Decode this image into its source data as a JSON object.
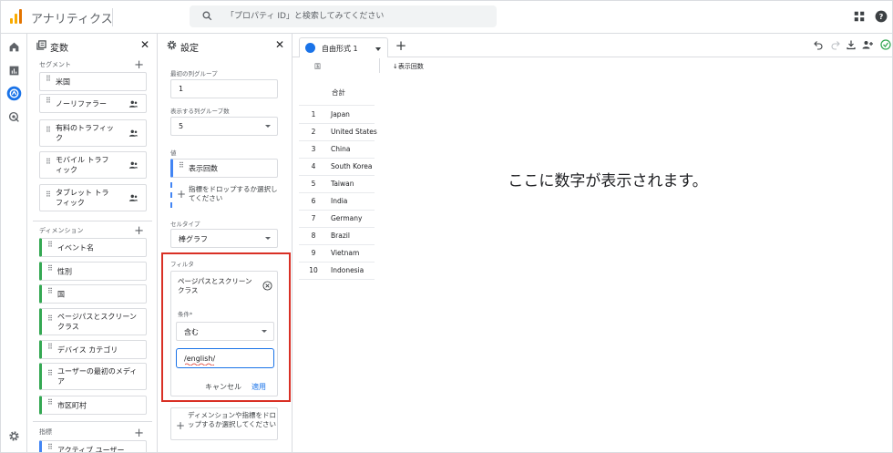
{
  "header": {
    "app_title": "アナリティクス",
    "search_placeholder": "「プロパティ ID」と検索してみてください",
    "icons": [
      "apps-grid-icon",
      "help-icon"
    ]
  },
  "rail": {
    "icons": [
      "home-icon",
      "reports-icon",
      "explore-icon",
      "advertising-icon",
      "settings-icon"
    ]
  },
  "variables_panel": {
    "title": "変数",
    "segments_label": "セグメント",
    "segments": [
      {
        "label": "米国",
        "audience": false
      },
      {
        "label": "ノーリファラー",
        "audience": true
      },
      {
        "label": "有料のトラフィック",
        "audience": true
      },
      {
        "label": "モバイル トラフィック",
        "audience": true
      },
      {
        "label": "タブレット トラフィック",
        "audience": true
      }
    ],
    "dimensions_label": "ディメンション",
    "dimensions": [
      "イベント名",
      "性別",
      "国",
      "ページパスとスクリーン クラス",
      "デバイス カテゴリ",
      "ユーザーの最初のメディア",
      "市区町村"
    ],
    "metrics_label": "指標",
    "metrics": [
      "アクティブ ユーザー"
    ]
  },
  "settings_panel": {
    "title": "設定",
    "start_group_label": "最初の列グループ",
    "start_group_value": "1",
    "show_groups_label": "表示する列グループ数",
    "show_groups_value": "5",
    "values_label": "値",
    "values_item": "表示回数",
    "values_drop": "指標をドロップするか選択してください",
    "cell_type_label": "セルタイプ",
    "cell_type_value": "棒グラフ",
    "filter_label": "フィルタ",
    "filter": {
      "dimension": "ページパスとスクリーン クラス",
      "condition_label": "条件*",
      "condition_value": "含む",
      "input_value": "/english/",
      "cancel": "キャンセル",
      "apply": "適用"
    },
    "filter_drop": "ディメンションや指標をドロップするか選択してください"
  },
  "canvas": {
    "tab_label": "自由形式 1",
    "column_header": "国",
    "metric_header": "↓表示回数",
    "total_label": "合計",
    "rows": [
      {
        "n": "1",
        "country": "Japan"
      },
      {
        "n": "2",
        "country": "United States"
      },
      {
        "n": "3",
        "country": "China"
      },
      {
        "n": "4",
        "country": "South Korea"
      },
      {
        "n": "5",
        "country": "Taiwan"
      },
      {
        "n": "6",
        "country": "India"
      },
      {
        "n": "7",
        "country": "Germany"
      },
      {
        "n": "8",
        "country": "Brazil"
      },
      {
        "n": "9",
        "country": "Vietnam"
      },
      {
        "n": "10",
        "country": "Indonesia"
      }
    ],
    "placeholder": "ここに数字が表示されます。"
  },
  "colors": {
    "accent": "#1a73e8",
    "dimension": "#34a853",
    "metric": "#4285f4",
    "highlight": "#d93025",
    "logo": "#f9ab00"
  }
}
